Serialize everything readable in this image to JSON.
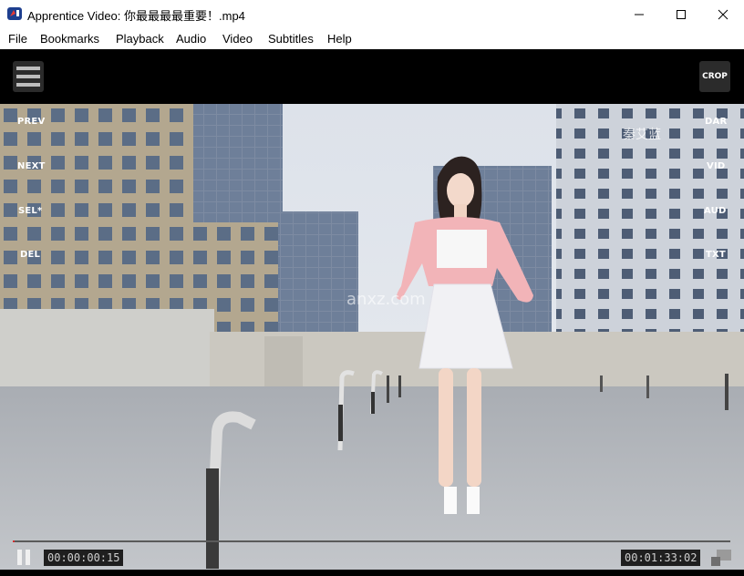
{
  "window": {
    "title": "Apprentice Video: 你最最最最重要！.mp4"
  },
  "menu": [
    "File",
    "Bookmarks",
    "Playback",
    "Audio",
    "Video",
    "Subtitles",
    "Help"
  ],
  "overlay": {
    "left": [
      "PREV",
      "NEXT",
      "SEL*",
      "DEL"
    ],
    "right": [
      "DAR",
      "VID",
      "AUD",
      "TXT"
    ],
    "crop": "CROP"
  },
  "playback": {
    "elapsed": "00:00:00:15",
    "total": "00:01:33:02",
    "progress_fraction": 0.003,
    "state": "playing"
  },
  "watermarks": {
    "channel": "秦艾蓝",
    "site": "anxz.com"
  },
  "colors": {
    "progress": "#d32f2f",
    "background": "#000000"
  }
}
